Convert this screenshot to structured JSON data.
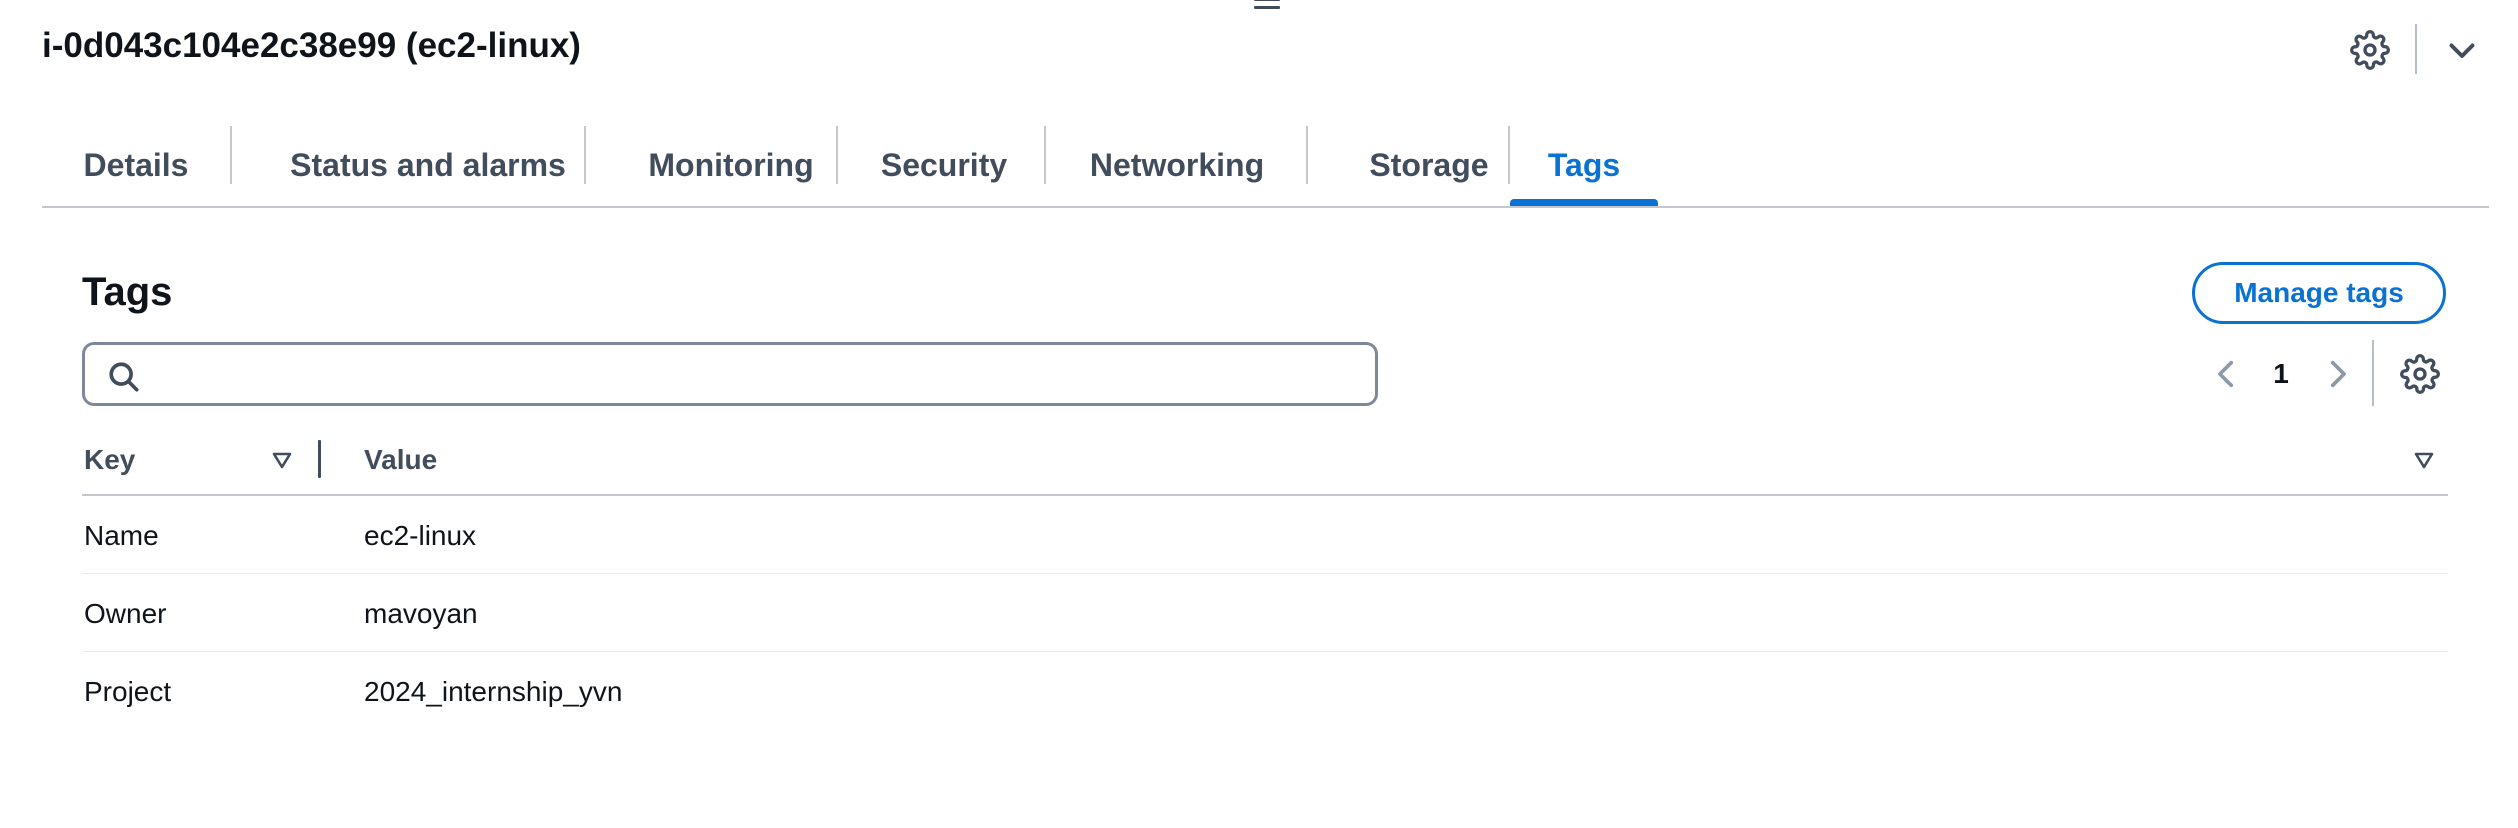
{
  "header": {
    "title": "i-0d043c104e2c38e99 (ec2-linux)"
  },
  "tabs": [
    {
      "label": "Details",
      "active": false
    },
    {
      "label": "Status and alarms",
      "active": false
    },
    {
      "label": "Monitoring",
      "active": false
    },
    {
      "label": "Security",
      "active": false
    },
    {
      "label": "Networking",
      "active": false
    },
    {
      "label": "Storage",
      "active": false
    },
    {
      "label": "Tags",
      "active": true
    }
  ],
  "tags_section": {
    "title": "Tags",
    "manage_button": "Manage tags",
    "search": {
      "value": "",
      "placeholder": ""
    },
    "pagination": {
      "current_page": "1"
    },
    "columns": {
      "key": "Key",
      "value": "Value"
    },
    "rows": [
      {
        "key": "Name",
        "value": "ec2-linux"
      },
      {
        "key": "Owner",
        "value": "mavoyan"
      },
      {
        "key": "Project",
        "value": "2024_internship_yvn"
      }
    ]
  },
  "icons": {
    "header_settings": "gear-icon",
    "header_collapse": "chevron-down-icon",
    "search": "search-icon",
    "pager_prev": "chevron-left-icon",
    "pager_next": "chevron-right-icon",
    "table_preferences": "gear-icon",
    "sort": "caret-down-icon",
    "drag_handle": "drag-handle-icon"
  },
  "colors": {
    "accent": "#0972d3",
    "text": "#0f141a",
    "secondary_text": "#414d5c",
    "border": "#c6c6cd"
  }
}
